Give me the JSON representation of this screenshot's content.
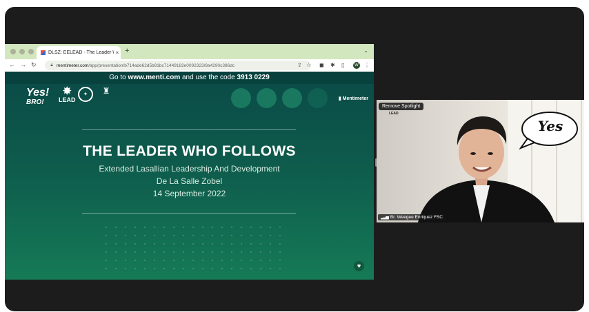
{
  "browser": {
    "tab_title": "DLSZ: EELEAD - The Leader W",
    "tab_close": "×",
    "new_tab": "+",
    "url_host": "mentimeter.com",
    "url_path": "/app/presentation/b714ade62d5b91bc71449182e0092323/8a4290c386dc",
    "avatar_letter": "W"
  },
  "slide": {
    "join_prefix": "Go to ",
    "join_url": "www.menti.com",
    "join_mid": " and use the code ",
    "join_code": "3913 0229",
    "logo_yes": "Yes!",
    "logo_bro": "BRO!",
    "logo_lead": "LEAD",
    "brand": "Mentimeter",
    "title": "THE LEADER WHO FOLLOWS",
    "subtitle": "Extended Lasallian Leadership And Development",
    "school": "De La Salle Zobel",
    "date": "14 September 2022"
  },
  "video": {
    "remove_spotlight": "Remove Spotlight",
    "participant_name": "Br. Weegee Enriquez FSC",
    "bubble_text": "Yes",
    "logo_lead": "LEAD"
  },
  "colors": {
    "tabbar": "#d3e7bf",
    "slide_top": "#0a4a47",
    "slide_bottom": "#157a56",
    "frame": "#1c1c1c"
  }
}
